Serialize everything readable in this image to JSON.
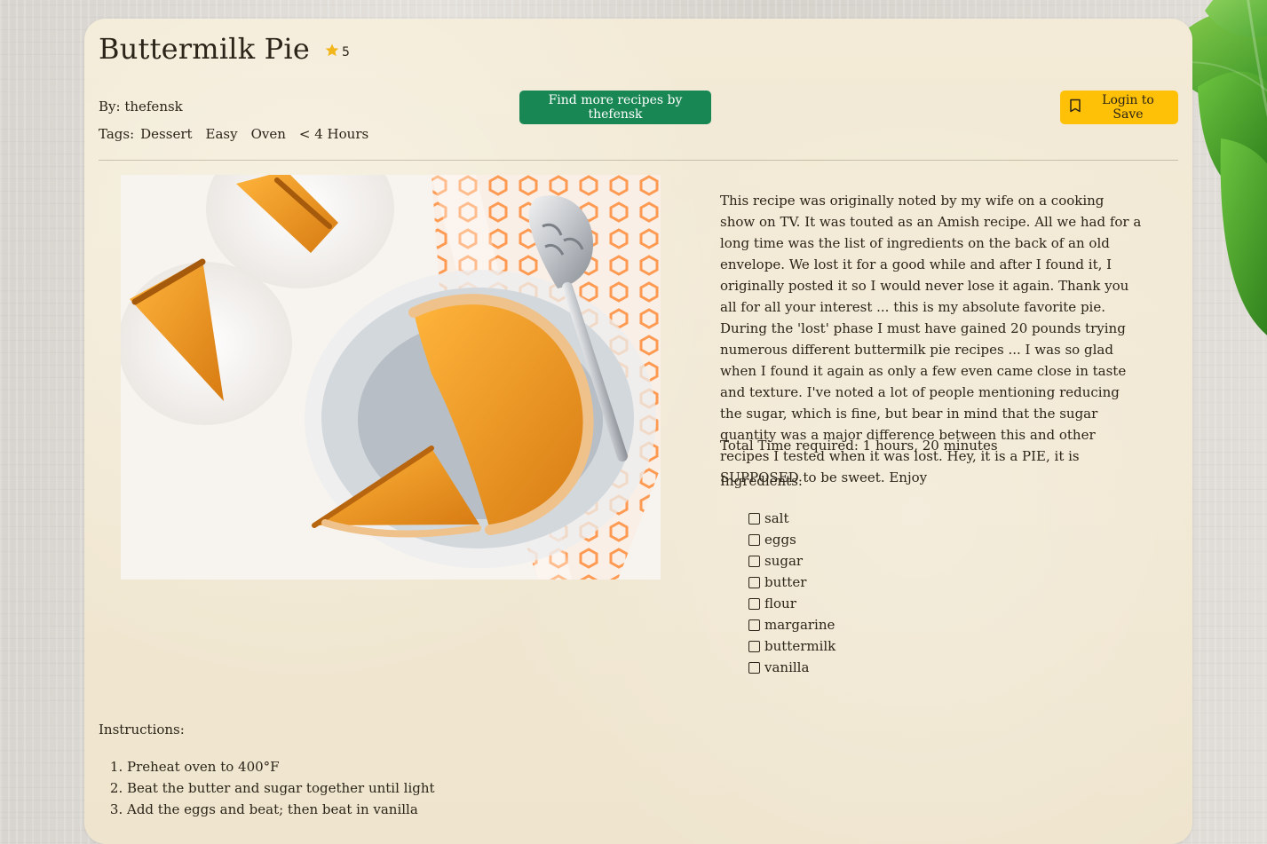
{
  "recipe": {
    "title": "Buttermilk Pie",
    "rating": "5",
    "byline": "By: thefensk",
    "tags_label": "Tags:",
    "tags": [
      "Dessert",
      "Easy",
      "Oven",
      "< 4 Hours"
    ],
    "find_more_label": "Find more recipes by thefensk",
    "save_label": "Login to Save",
    "description": "This recipe was originally noted by my wife on a cooking show on TV. It was touted as an Amish recipe. All we had for a long time was the list of ingredients on the back of an old envelope. We lost it for a good while and after I found it, I originally posted it so I would never lose it again. Thank you all for all your interest ... this is my absolute favorite pie. During the 'lost' phase I must have gained 20 pounds trying numerous different buttermilk pie recipes ... I was so glad when I found it again as only a few even came close in taste and texture. I've noted a lot of people mentioning reducing the sugar, which is fine, but bear in mind that the sugar quantity was a major difference between this and other recipes I tested when it was lost. Hey, it is a PIE, it is SUPPOSED to be sweet. Enjoy",
    "total_time": "Total Time required: 1 hours, 20 minutes",
    "ingredients_label": "Ingredients:",
    "ingredients": [
      "salt",
      "eggs",
      "sugar",
      "butter",
      "flour",
      "margarine",
      "buttermilk",
      "vanilla"
    ],
    "instructions_label": "Instructions:",
    "instructions": [
      "Preheat oven to 400°F",
      "Beat the butter and sugar together until light",
      "Add the eggs and beat; then beat in vanilla"
    ]
  },
  "icons": {
    "rating": "star-icon",
    "save": "bookmark-icon"
  },
  "colors": {
    "star": "#f2b61b",
    "find_more_button": "#198754",
    "save_button": "#ffc107",
    "card": "#f1e8d3"
  }
}
